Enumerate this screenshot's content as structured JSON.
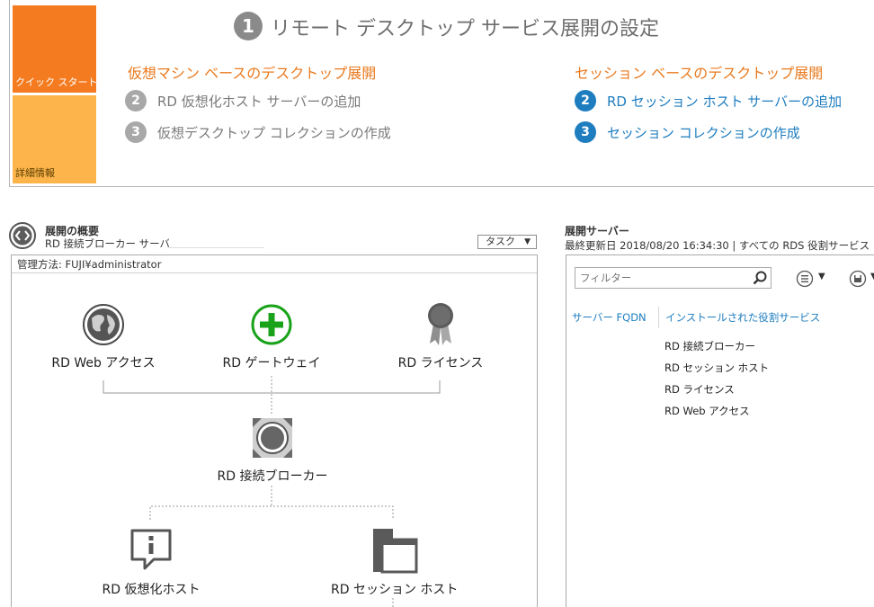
{
  "quick_start": {
    "tile_quick_start": "クイック スタート",
    "tile_details": "詳細情報",
    "main_step_number": "1",
    "main_title": "リモート デスクトップ サービス展開の設定",
    "vm_section": {
      "heading": "仮想マシン ベースのデスクトップ展開",
      "steps": [
        {
          "number": "2",
          "label": "RD 仮想化ホスト サーバーの追加"
        },
        {
          "number": "3",
          "label": "仮想デスクトップ コレクションの作成"
        }
      ]
    },
    "session_section": {
      "heading": "セッション ベースのデスクトップ展開",
      "steps": [
        {
          "number": "2",
          "label": "RD セッション ホスト サーバーの追加"
        },
        {
          "number": "3",
          "label": "セッション コレクションの作成"
        }
      ]
    }
  },
  "overview": {
    "title": "展開の概要",
    "broker_line": "RD 接続ブローカー サーバー:",
    "task_button": "タスク",
    "managed_by": "管理方法: FUJI¥administrator",
    "nodes": {
      "web_access": "RD Web アクセス",
      "gateway": "RD ゲートウェイ",
      "licensing": "RD ライセンス",
      "broker": "RD 接続ブローカー",
      "virtualization_host": "RD 仮想化ホスト",
      "session_host": "RD セッション ホスト"
    }
  },
  "servers": {
    "title": "展開サーバー",
    "last_updated": "最終更新日 2018/08/20 16:34:30 | すべての RDS 役割サービス",
    "filter_placeholder": "フィルター",
    "columns": [
      "サーバー FQDN",
      "インストールされた役割サービス"
    ],
    "roles": [
      "RD 接続ブローカー",
      "RD セッション ホスト",
      "RD ライセンス",
      "RD Web アクセス"
    ]
  },
  "colors": {
    "orange_tile": "#f47b20",
    "light_orange_tile": "#fdb54b",
    "section_heading": "#ea7a1e",
    "link_blue": "#1e7dbf",
    "gateway_green": "#1aa31a"
  }
}
